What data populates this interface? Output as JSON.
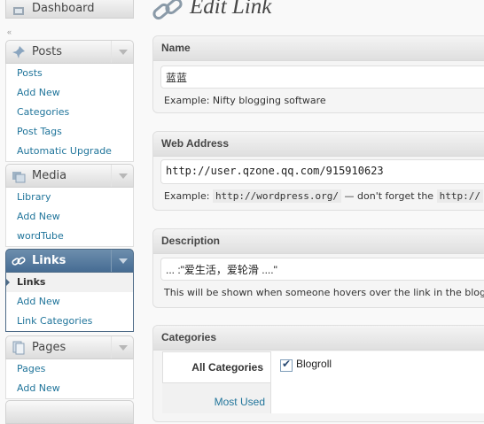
{
  "sidebar": {
    "dashboard": {
      "label": "Dashboard"
    },
    "posts": {
      "label": "Posts",
      "items": [
        "Posts",
        "Add New",
        "Categories",
        "Post Tags",
        "Automatic Upgrade"
      ]
    },
    "media": {
      "label": "Media",
      "items": [
        "Library",
        "Add New",
        "wordTube"
      ]
    },
    "links": {
      "label": "Links",
      "items": [
        "Links",
        "Add New",
        "Link Categories"
      ],
      "active_item": "Links"
    },
    "pages": {
      "label": "Pages",
      "items": [
        "Pages",
        "Add New"
      ]
    }
  },
  "page": {
    "title": "Edit Link"
  },
  "name_box": {
    "title": "Name",
    "value": "蓝蓝",
    "help": "Example: Nifty blogging software"
  },
  "address_box": {
    "title": "Web Address",
    "value": "http://user.qzone.qq.com/915910623",
    "help_prefix": "Example:",
    "help_code1": "http://wordpress.org/",
    "help_mid": "— don't forget the",
    "help_code2": "http://"
  },
  "description_box": {
    "title": "Description",
    "value": "... :\"爱生活，爱轮滑 ....\"",
    "help": "This will be shown when someone hovers over the link in the blogroll"
  },
  "categories_box": {
    "title": "Categories",
    "tabs": [
      "All Categories",
      "Most Used"
    ],
    "categories": [
      {
        "label": "Blogroll",
        "checked": true
      }
    ]
  },
  "colors": {
    "accent": "#21759b",
    "current_menu": "#466c93"
  }
}
